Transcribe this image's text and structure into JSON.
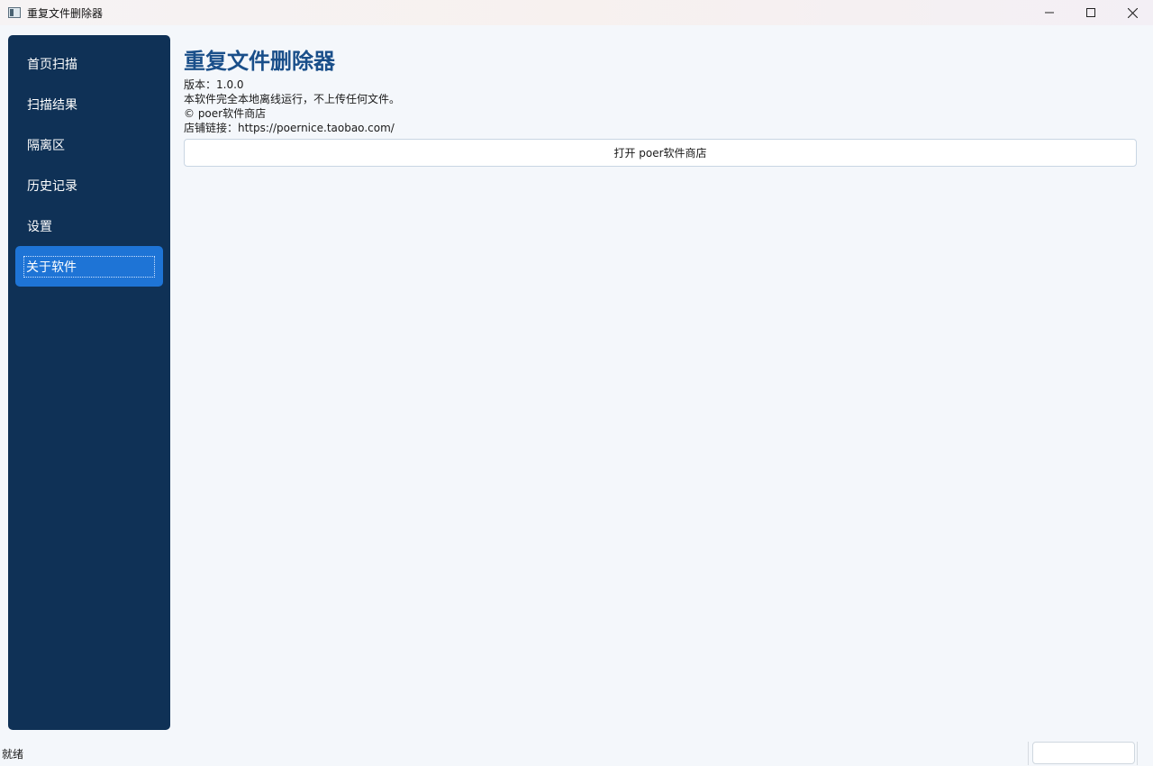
{
  "window": {
    "title": "重复文件删除器",
    "controls": [
      "minimize-icon",
      "maximize-icon",
      "close-icon"
    ]
  },
  "sidebar": {
    "items": [
      {
        "label": "首页扫描",
        "active": false
      },
      {
        "label": "扫描结果",
        "active": false
      },
      {
        "label": "隔离区",
        "active": false
      },
      {
        "label": "历史记录",
        "active": false
      },
      {
        "label": "设置",
        "active": false
      },
      {
        "label": "关于软件",
        "active": true
      }
    ]
  },
  "about": {
    "title": "重复文件删除器",
    "version": "版本：1.0.0",
    "description": "本软件完全本地离线运行，不上传任何文件。",
    "copyright": "© poer软件商店",
    "store_link": "店铺链接：https://poernice.taobao.com/",
    "store_button": "打开 poer软件商店"
  },
  "status": {
    "text": "就绪"
  },
  "colors": {
    "sidebar_bg": "#0f3156",
    "active_item": "#1e74d6",
    "title": "#1a4f8a",
    "page_bg": "#f4f7fb"
  }
}
